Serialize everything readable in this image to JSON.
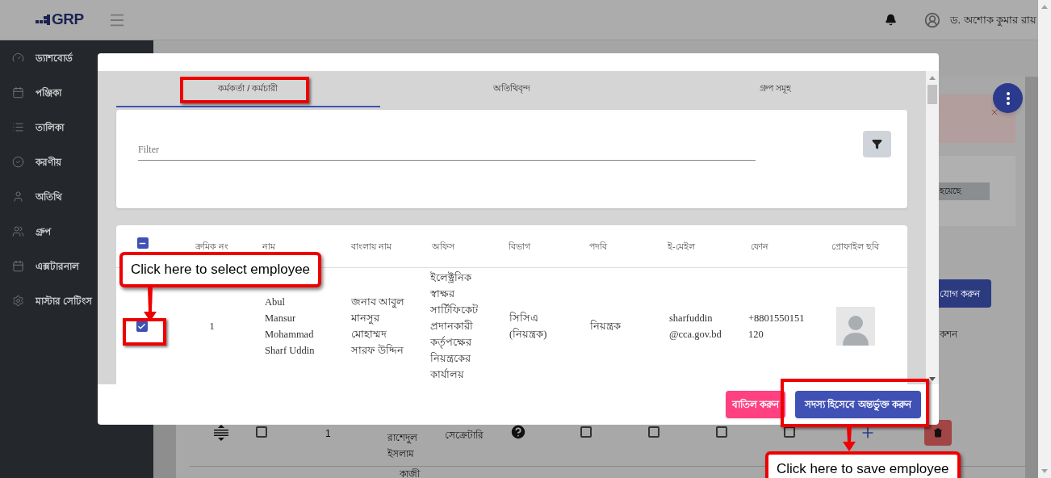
{
  "topbar": {
    "logo": "GRP",
    "user_name": "ড. অশোক কুমার রায়"
  },
  "sidebar": {
    "items": [
      {
        "kind": "gauge",
        "label": "ড্যাশবোর্ড"
      },
      {
        "kind": "calendar",
        "label": "পঞ্জিকা"
      },
      {
        "kind": "list",
        "label": "তালিকা"
      },
      {
        "kind": "check",
        "label": "করণীয়"
      },
      {
        "kind": "user",
        "label": "অতিথি"
      },
      {
        "kind": "group",
        "label": "গ্রুপ"
      },
      {
        "kind": "calendar",
        "label": "এক্সটারনাল"
      },
      {
        "kind": "gear",
        "label": "মাস্টার সেটিংস"
      }
    ]
  },
  "background": {
    "status_pill": "হয়েছে",
    "add_button": "যোগ করুন",
    "action_header": "কশন",
    "row": {
      "serial": "1",
      "name_lines": [
        "রাশেদুল",
        "ইসলাম"
      ],
      "role": "সেক্রেটারি",
      "checked": false,
      "flags": [
        {
          "checked": false
        },
        {
          "checked": false
        },
        {
          "checked": false
        },
        {
          "checked": false
        }
      ]
    },
    "next_row_name": "কাজী"
  },
  "modal": {
    "tabs": [
      {
        "label": "কর্মকর্তা / কর্মচারী",
        "selected": true
      },
      {
        "label": "অতিথিবৃন্দ",
        "selected": false
      },
      {
        "label": "গ্রুপ সমূহ",
        "selected": false
      }
    ],
    "filter": {
      "placeholder": "Filter"
    },
    "table": {
      "select_all_partial": true,
      "columns": [
        "ক্রমিক নং",
        "নাম",
        "বাংলায় নাম",
        "অফিস",
        "বিভাগ",
        "পদবি",
        "ই-মেইল",
        "ফোন",
        "প্রোফাইল ছবি"
      ],
      "rows": [
        {
          "selected": true,
          "serial": "1",
          "name": [
            "Abul",
            "Mansur",
            "Mohammad",
            "Sharf Uddin"
          ],
          "bangla_name": [
            "জনাব আবুল",
            "মানসুর",
            "মোহাম্মদ",
            "সারফ উদ্দিন"
          ],
          "office": [
            "ইলেক্ট্রনিক",
            "স্বাক্ষর",
            "সার্টিফিকেট",
            "প্রদানকারী",
            "কর্তৃপক্ষের",
            "নিয়ন্ত্রকের",
            "কার্যালয়"
          ],
          "department": [
            "সিসিএ",
            "(নিয়ন্ত্রক)"
          ],
          "designation": [
            "নিয়ন্ত্রক"
          ],
          "email": [
            "sharfuddin",
            "@cca.gov.bd"
          ],
          "phone": [
            "+8801550151",
            "120"
          ]
        }
      ]
    },
    "buttons": {
      "cancel": "বাতিল করুন",
      "save": "সদস্য হিসেবে অন্তর্ভুক্ত করুন"
    }
  },
  "annotations": [
    {
      "kind": "callout",
      "text": "Click here to select employee"
    },
    {
      "kind": "callout",
      "text": "Click here to save employee"
    }
  ]
}
